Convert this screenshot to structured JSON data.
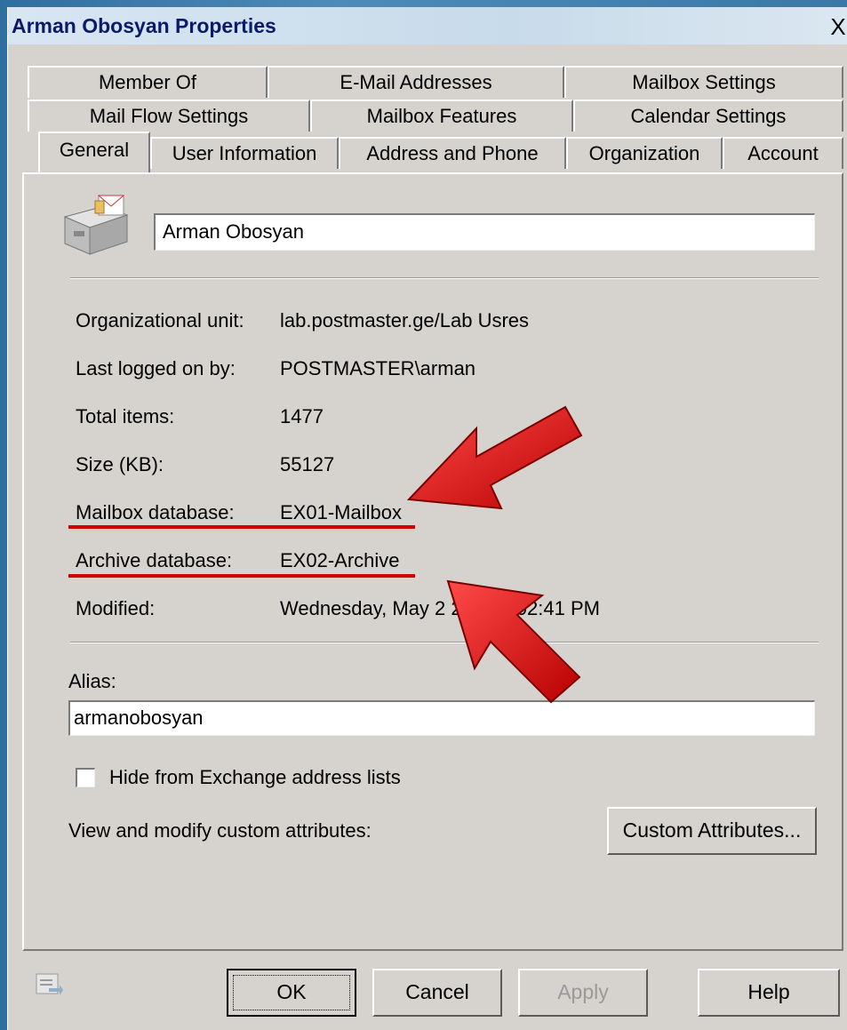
{
  "window": {
    "title": "Arman Obosyan Properties",
    "close_glyph": "X"
  },
  "tabs": {
    "row1": [
      "Member Of",
      "E-Mail Addresses",
      "Mailbox Settings"
    ],
    "row2": [
      "Mail Flow Settings",
      "Mailbox Features",
      "Calendar Settings"
    ],
    "row3": [
      "General",
      "User Information",
      "Address and Phone",
      "Organization",
      "Account"
    ],
    "active": "General"
  },
  "general": {
    "display_name": "Arman Obosyan",
    "rows": [
      {
        "label": "Organizational unit:",
        "value": "lab.postmaster.ge/Lab Usres"
      },
      {
        "label": "Last logged on by:",
        "value": "POSTMASTER\\arman"
      },
      {
        "label": "Total items:",
        "value": "1477"
      },
      {
        "label": "Size (KB):",
        "value": "55127"
      },
      {
        "label": "Mailbox database:",
        "value": "EX01-Mailbox"
      },
      {
        "label": "Archive database:",
        "value": "EX02-Archive"
      },
      {
        "label": "Modified:",
        "value": "Wednesday, May 2 2010 9:02:41 PM"
      }
    ],
    "alias_label": "Alias:",
    "alias_value": "armanobosyan",
    "hide_checkbox_label": "Hide from Exchange address lists",
    "custom_attr_label": "View and modify custom attributes:",
    "custom_attr_button": "Custom Attributes..."
  },
  "buttons": {
    "ok": "OK",
    "cancel": "Cancel",
    "apply": "Apply",
    "help": "Help"
  },
  "icons": {
    "mailbox": "mailbox-icon",
    "properties": "properties-icon",
    "annotation": "red-arrow-icon"
  },
  "colors": {
    "title_text": "#0b1a6b",
    "annotation_red": "#d40000",
    "dialog_face": "#d6d3ce"
  }
}
